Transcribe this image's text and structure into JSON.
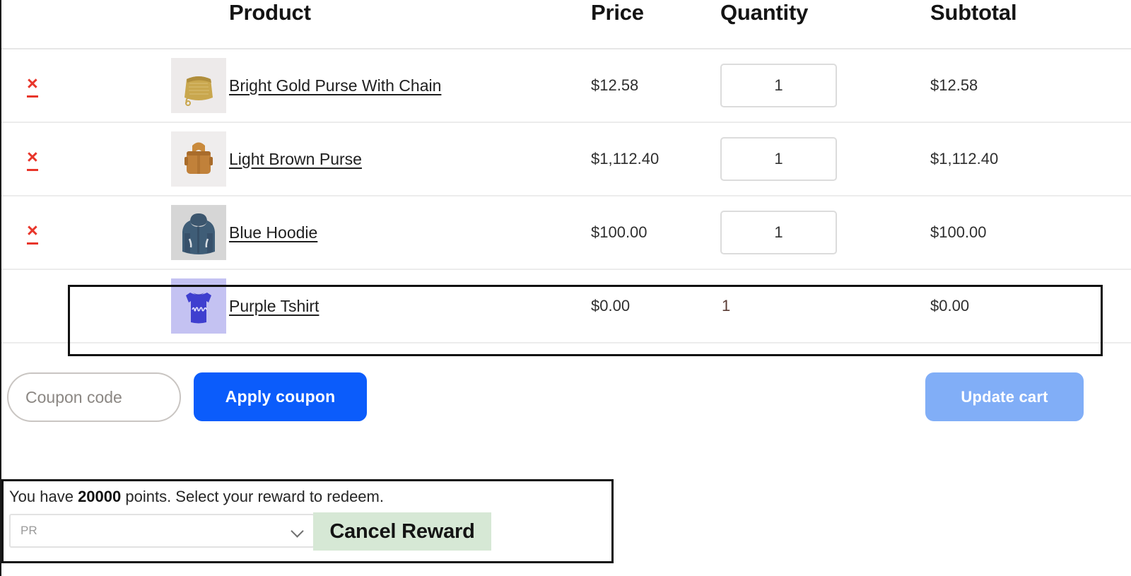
{
  "table": {
    "columns": {
      "remove": "",
      "thumbnail": "",
      "product": "Product",
      "price": "Price",
      "quantity": "Quantity",
      "subtotal": "Subtotal"
    },
    "remove_icon_label": "×",
    "rows": [
      {
        "name": "Bright Gold Purse With Chain",
        "price": "$12.58",
        "quantity": "1",
        "subtotal": "$12.58",
        "thumb_name": "bright-gold-purse-thumbnail",
        "has_qty_input": true,
        "removable": true,
        "highlighted": false
      },
      {
        "name": "Light Brown Purse",
        "price": "$1,112.40",
        "quantity": "1",
        "subtotal": "$1,112.40",
        "thumb_name": "light-brown-purse-thumbnail",
        "has_qty_input": true,
        "removable": true,
        "highlighted": false
      },
      {
        "name": "Blue Hoodie",
        "price": "$100.00",
        "quantity": "1",
        "subtotal": "$100.00",
        "thumb_name": "blue-hoodie-thumbnail",
        "has_qty_input": true,
        "removable": true,
        "highlighted": false
      },
      {
        "name": "Purple Tshirt",
        "price": "$0.00",
        "quantity": "1",
        "subtotal": "$0.00",
        "thumb_name": "purple-tshirt-thumbnail",
        "has_qty_input": false,
        "removable": false,
        "highlighted": true
      }
    ]
  },
  "coupon": {
    "placeholder": "Coupon code",
    "value": "",
    "apply_label": "Apply coupon",
    "update_cart_label": "Update cart"
  },
  "reward": {
    "message_prefix": "You have ",
    "points": "20000",
    "message_suffix": " points. Select your reward to redeem.",
    "select_value": "PR",
    "cancel_label": "Cancel Reward"
  },
  "colors": {
    "apply_coupon_bg": "#0b5cfb",
    "update_cart_bg": "#81aef7",
    "remove_icon": "#e8352a",
    "cancel_reward_bg": "#d6e8d5",
    "row_divider": "#ececec",
    "highlight_border": "#111111"
  }
}
